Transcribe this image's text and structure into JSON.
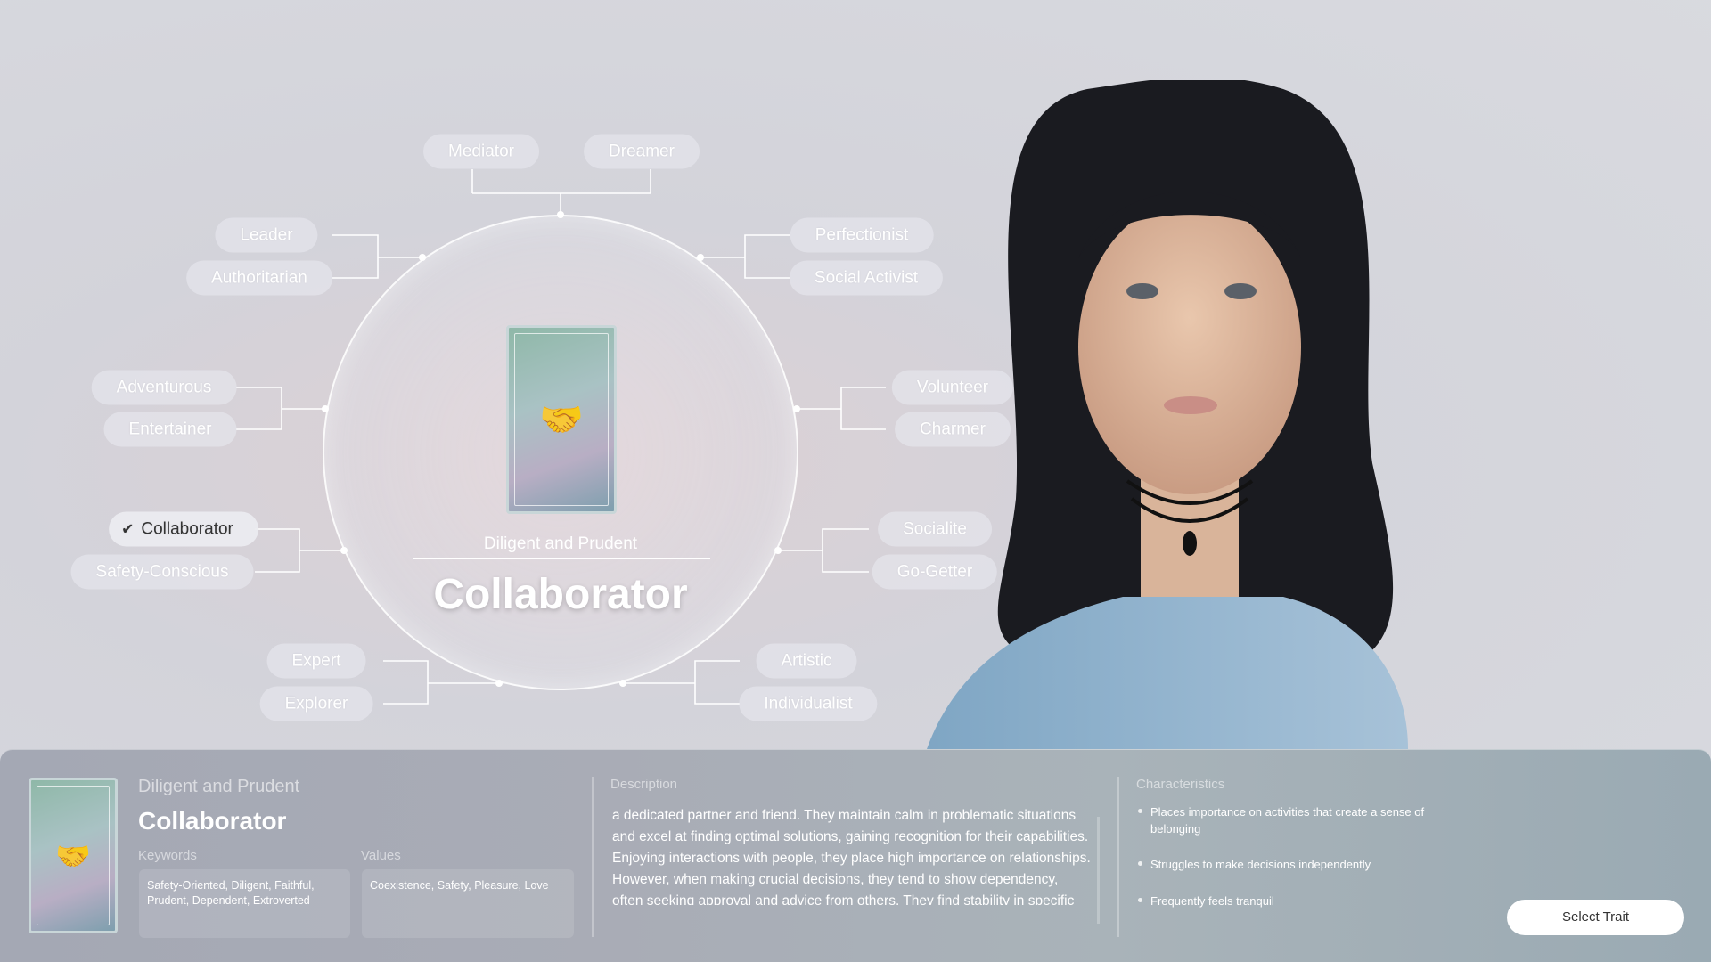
{
  "traits": {
    "mediator": "Mediator",
    "dreamer": "Dreamer",
    "leader": "Leader",
    "authoritarian": "Authoritarian",
    "perfectionist": "Perfectionist",
    "social_activist": "Social Activist",
    "adventurous": "Adventurous",
    "entertainer": "Entertainer",
    "volunteer": "Volunteer",
    "charmer": "Charmer",
    "collaborator": "Collaborator",
    "safety_conscious": "Safety-Conscious",
    "socialite": "Socialite",
    "go_getter": "Go-Getter",
    "expert": "Expert",
    "explorer": "Explorer",
    "artistic": "Artistic",
    "individualist": "Individualist"
  },
  "selected": {
    "check_icon": "✔",
    "subtitle": "Diligent and Prudent",
    "title": "Collaborator"
  },
  "panel": {
    "subtitle": "Diligent and Prudent",
    "title": "Collaborator",
    "keywords_label": "Keywords",
    "keywords": "Safety-Oriented, Diligent, Faithful, Prudent, Dependent, Extroverted",
    "values_label": "Values",
    "values": "Coexistence, Safety, Pleasure, Love",
    "description_label": "Description",
    "description": "a dedicated partner and friend. They maintain calm in problematic situations and excel at finding optimal solutions, gaining recognition for their capabilities. Enjoying interactions with people, they place high importance on relationships. However, when making crucial decisions, they tend to show dependency, often seeking approval and advice from others. They find stability in specific organizations or groups and prefer working with",
    "characteristics_label": "Characteristics",
    "characteristics": [
      "Places importance on activities that create a sense of belonging",
      "Struggles to make decisions independently",
      "Frequently feels tranquil"
    ],
    "select_button": "Select Trait"
  }
}
